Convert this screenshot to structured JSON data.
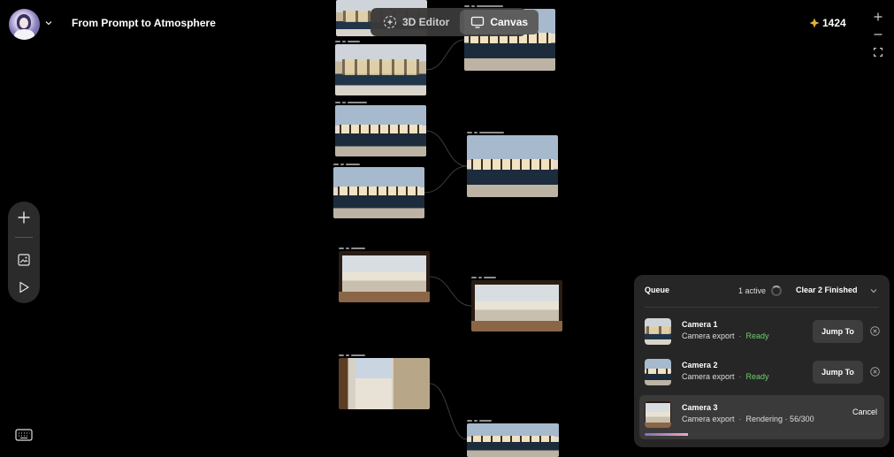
{
  "header": {
    "project_title": "From Prompt to Atmosphere",
    "credits": "1424",
    "credits_icon": "diamond-icon",
    "credits_color": "#e5b23a"
  },
  "mode_toggle": {
    "editor_label": "3D Editor",
    "canvas_label": "Canvas",
    "active": "Canvas"
  },
  "toolbar": {
    "items": [
      "plus-icon",
      "image-frame-icon",
      "play-icon"
    ],
    "keyboard": "keyboard-icon"
  },
  "zoom": [
    "plus-icon",
    "minus-icon",
    "fit-screen-icon"
  ],
  "queue": {
    "title": "Queue",
    "active_text": "1 active",
    "clear_label": "Clear 2 Finished",
    "jump_label": "Jump To",
    "cancel_label": "Cancel",
    "items": [
      {
        "name": "Camera 1",
        "type": "Camera export",
        "status": "Ready",
        "status_color": "#6fcf6a"
      },
      {
        "name": "Camera 2",
        "type": "Camera export",
        "status": "Ready",
        "status_color": "#6fcf6a"
      },
      {
        "name": "Camera 3",
        "type": "Camera export",
        "status": "Rendering · 56/300",
        "progress": 0.1867
      }
    ]
  }
}
